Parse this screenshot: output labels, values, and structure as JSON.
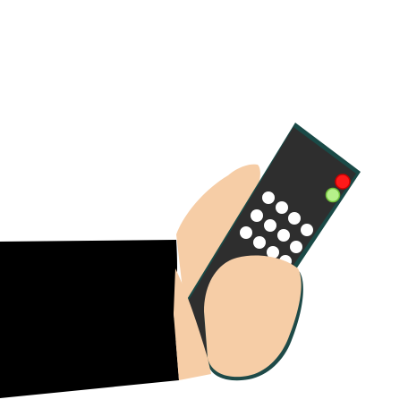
{
  "scene": {
    "background_color": "#ffffff",
    "sleeve_color": "#000000",
    "skin_color": "#f6cda6",
    "skin_shadow_color": "#1e4a48",
    "remote_body_color": "#2e2e2e",
    "remote_edge_color": "#1a4a47",
    "keypad_button_color": "#ffffff",
    "power_button_color": "#ff1a1a",
    "power_button_glow": "#cc0000",
    "status_button_color": "#b6f08a",
    "status_button_glow": "#6fbf3a"
  }
}
